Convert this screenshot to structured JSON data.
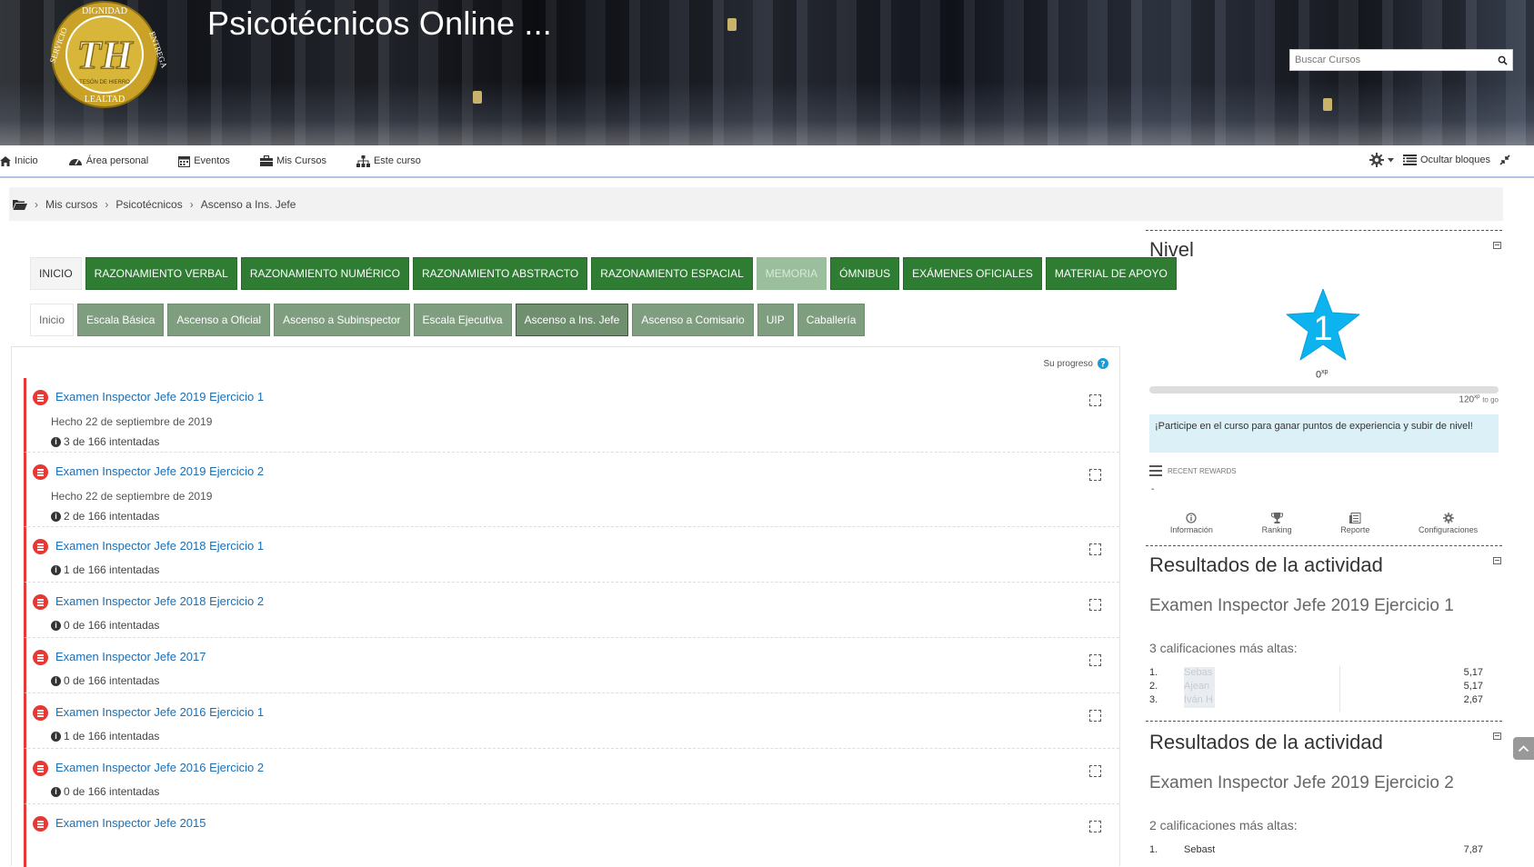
{
  "header": {
    "site_title": "Psicotécnicos Online ...",
    "logo_text": [
      "DIGNIDAD",
      "SERVICIO",
      "ENTREGA",
      "LEALTAD",
      "TH",
      "TESÓN DE HIERRO"
    ],
    "search_placeholder": "Buscar Cursos"
  },
  "nav": {
    "items": [
      {
        "label": "Inicio",
        "icon": "home-icon"
      },
      {
        "label": "Área personal",
        "icon": "dashboard-icon"
      },
      {
        "label": "Eventos",
        "icon": "calendar-icon"
      },
      {
        "label": "Mis Cursos",
        "icon": "briefcase-icon"
      },
      {
        "label": "Este curso",
        "icon": "sitemap-icon"
      }
    ],
    "hide_blocks": "Ocultar bloques"
  },
  "breadcrumb": [
    "Mis cursos",
    "Psicotécnicos",
    "Ascenso a Ins. Jefe"
  ],
  "tabs_main": [
    {
      "label": "INICIO",
      "state": "active"
    },
    {
      "label": "RAZONAMIENTO VERBAL",
      "state": "normal"
    },
    {
      "label": "RAZONAMIENTO NUMÉRICO",
      "state": "normal"
    },
    {
      "label": "RAZONAMIENTO ABSTRACTO",
      "state": "normal"
    },
    {
      "label": "RAZONAMIENTO ESPACIAL",
      "state": "normal"
    },
    {
      "label": "MEMORIA",
      "state": "disabled"
    },
    {
      "label": "ÓMNIBUS",
      "state": "normal"
    },
    {
      "label": "EXÁMENES OFICIALES",
      "state": "normal"
    },
    {
      "label": "MATERIAL DE APOYO",
      "state": "normal"
    }
  ],
  "tabs_sub": [
    {
      "label": "Inicio",
      "state": "active"
    },
    {
      "label": "Escala Básica",
      "state": "normal"
    },
    {
      "label": "Ascenso a Oficial",
      "state": "normal"
    },
    {
      "label": "Ascenso a Subinspector",
      "state": "normal"
    },
    {
      "label": "Escala Ejecutiva",
      "state": "normal"
    },
    {
      "label": "Ascenso a Ins. Jefe",
      "state": "current"
    },
    {
      "label": "Ascenso a Comisario",
      "state": "normal"
    },
    {
      "label": "UIP",
      "state": "normal"
    },
    {
      "label": "Caballería",
      "state": "normal"
    }
  ],
  "progress_label": "Su progreso",
  "activities": [
    {
      "name": "Examen Inspector Jefe 2019 Ejercicio 1",
      "date": "Hecho 22 de septiembre de 2019",
      "tries": "3 de 166 intentadas"
    },
    {
      "name": "Examen Inspector Jefe 2019 Ejercicio 2",
      "date": "Hecho 22 de septiembre de 2019",
      "tries": "2 de 166 intentadas"
    },
    {
      "name": "Examen Inspector Jefe 2018 Ejercicio 1",
      "date": "",
      "tries": "1 de 166 intentadas"
    },
    {
      "name": "Examen Inspector Jefe 2018 Ejercicio 2",
      "date": "",
      "tries": "0 de 166 intentadas"
    },
    {
      "name": "Examen Inspector Jefe 2017",
      "date": "",
      "tries": "0 de 166 intentadas"
    },
    {
      "name": "Examen Inspector Jefe 2016 Ejercicio 1",
      "date": "",
      "tries": "1 de 166 intentadas"
    },
    {
      "name": "Examen Inspector Jefe 2016 Ejercicio 2",
      "date": "",
      "tries": "0 de 166 intentadas"
    },
    {
      "name": "Examen Inspector Jefe 2015",
      "date": "",
      "tries": ""
    }
  ],
  "level_block": {
    "title": "Nivel",
    "level": "1",
    "xp_current": "0",
    "xp_sup": "xp",
    "xp_goal": "120",
    "to_go": "to go",
    "progress_fraction": 0,
    "info_text": "¡Participe en el curso para ganar puntos de experiencia y subir de nivel!",
    "recent_rewards": "RECENT REWARDS",
    "rewards_empty": "-",
    "actions": [
      {
        "label": "Información",
        "icon": "info-icon"
      },
      {
        "label": "Ranking",
        "icon": "trophy-icon"
      },
      {
        "label": "Reporte",
        "icon": "report-icon"
      },
      {
        "label": "Configuraciones",
        "icon": "gear-icon"
      }
    ],
    "star_color": "#0db3ef"
  },
  "results_blocks": [
    {
      "title": "Resultados de la actividad",
      "activity": "Examen Inspector Jefe 2019 Ejercicio 1",
      "subtitle": "3 calificaciones más altas:",
      "rows": [
        {
          "rank": "1.",
          "name": "Sebas",
          "grade": "5,17"
        },
        {
          "rank": "2.",
          "name": "Ajean",
          "grade": "5,17"
        },
        {
          "rank": "3.",
          "name": "Iván H",
          "grade": "2,67"
        }
      ]
    },
    {
      "title": "Resultados de la actividad",
      "activity": "Examen Inspector Jefe 2019 Ejercicio 2",
      "subtitle": "2 calificaciones más altas:",
      "rows": [
        {
          "rank": "1.",
          "name": "Sebast",
          "grade": "7,87"
        }
      ]
    }
  ],
  "colors": {
    "accent_green": "#2e7d32",
    "sub_green": "#7f9e7f",
    "red": "#e53935",
    "link": "#1a6fb5"
  }
}
